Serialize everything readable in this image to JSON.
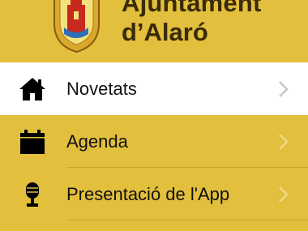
{
  "header": {
    "title_line1": "Ajuntament",
    "title_line2": "d’Alaró",
    "logo_icon": "coat-of-arms-icon"
  },
  "menu": {
    "items": [
      {
        "label": "Novetats",
        "icon": "home-icon",
        "selected": true
      },
      {
        "label": "Agenda",
        "icon": "calendar-icon",
        "selected": false
      },
      {
        "label": "Presentació de l'App",
        "icon": "microphone-icon",
        "selected": false
      }
    ]
  },
  "colors": {
    "background": "#E2BF3C",
    "selected_row": "#FFFFFF",
    "text": "#111111",
    "chevron": "#C8C8C8"
  }
}
